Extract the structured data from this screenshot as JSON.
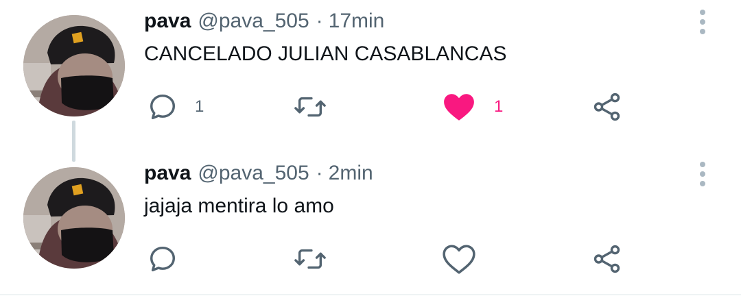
{
  "tweets": [
    {
      "author": {
        "name": "pava",
        "handle": "@pava_505"
      },
      "separator": "·",
      "time": "17min",
      "text": "CANCELADO JULIAN CASABLANCAS",
      "actions": {
        "reply_count": "1",
        "retweet_count": "",
        "like_count": "1",
        "liked": true
      }
    },
    {
      "author": {
        "name": "pava",
        "handle": "@pava_505"
      },
      "separator": "·",
      "time": "2min",
      "text": "jajaja mentira lo amo",
      "actions": {
        "reply_count": "",
        "retweet_count": "",
        "like_count": "",
        "liked": false
      }
    }
  ],
  "icons": {
    "reply": "reply-icon",
    "retweet": "retweet-icon",
    "like": "heart-icon",
    "share": "share-icon",
    "more": "more-vertical-icon"
  },
  "colors": {
    "like_active": "#f91880",
    "icon_gray": "#536471",
    "thread_line": "#cfd9de"
  }
}
